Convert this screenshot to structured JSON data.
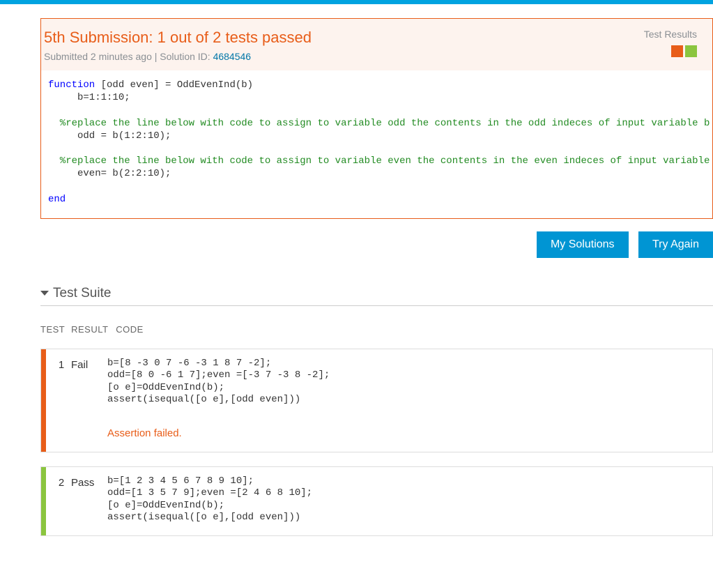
{
  "submission": {
    "title": "5th Submission: 1 out of 2 tests passed",
    "submitted": "Submitted 2 minutes ago",
    "sep": "  |  ",
    "solution_label": "Solution ID: ",
    "solution_id": "4684546",
    "test_results_label": "Test Results"
  },
  "code": {
    "l1a": "function",
    "l1b": " [odd even] = OddEvenInd(b)",
    "l2": "     b=1:1:10;",
    "l3": "     ",
    "l4": "  %replace the line below with code to assign to variable odd the contents in the odd indeces of input variable b",
    "l5": "     odd = b(1:2:10);",
    "l6": "     ",
    "l7": "  %replace the line below with code to assign to variable even the contents in the even indeces of input variable b",
    "l8": "     even= b(2:2:10);",
    "l9": "",
    "l10": "end"
  },
  "buttons": {
    "my_solutions": "My Solutions",
    "try_again": "Try Again"
  },
  "suite": {
    "title": "Test Suite",
    "col_test": "TEST",
    "col_result": "RESULT",
    "col_code": "CODE"
  },
  "tests": [
    {
      "num": "1",
      "result": "Fail",
      "status": "fail",
      "code": "b=[8 -3 0 7 -6 -3 1 8 7 -2];\nodd=[8 0 -6 1 7];even =[-3 7 -3 8 -2];\n[o e]=OddEvenInd(b);\nassert(isequal([o e],[odd even]))",
      "error": "Assertion failed."
    },
    {
      "num": "2",
      "result": "Pass",
      "status": "pass",
      "code": "b=[1 2 3 4 5 6 7 8 9 10];\nodd=[1 3 5 7 9];even =[2 4 6 8 10];\n[o e]=OddEvenInd(b);\nassert(isequal([o e],[odd even]))",
      "error": ""
    }
  ]
}
